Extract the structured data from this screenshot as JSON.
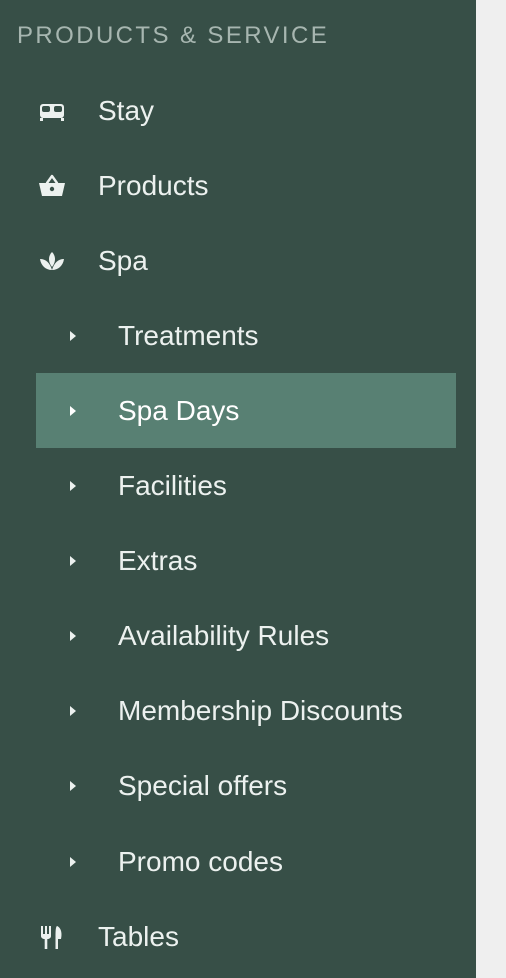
{
  "section": {
    "title": "PRODUCTS & SERVICE"
  },
  "nav": {
    "stay": {
      "label": "Stay",
      "icon": "bed-icon"
    },
    "products": {
      "label": "Products",
      "icon": "basket-icon"
    },
    "spa": {
      "label": "Spa",
      "icon": "lotus-icon",
      "children": [
        {
          "label": "Treatments"
        },
        {
          "label": "Spa Days",
          "active": true
        },
        {
          "label": "Facilities"
        },
        {
          "label": "Extras"
        },
        {
          "label": "Availability Rules"
        },
        {
          "label": "Membership Discounts"
        },
        {
          "label": "Special offers"
        },
        {
          "label": "Promo codes"
        }
      ]
    },
    "tables": {
      "label": "Tables",
      "icon": "fork-knife-icon"
    }
  },
  "colors": {
    "sidebar_bg": "#374f47",
    "active_bg": "#588073",
    "text": "#ecf1ef",
    "heading": "#a7b6b0",
    "page_bg": "#efefef"
  }
}
